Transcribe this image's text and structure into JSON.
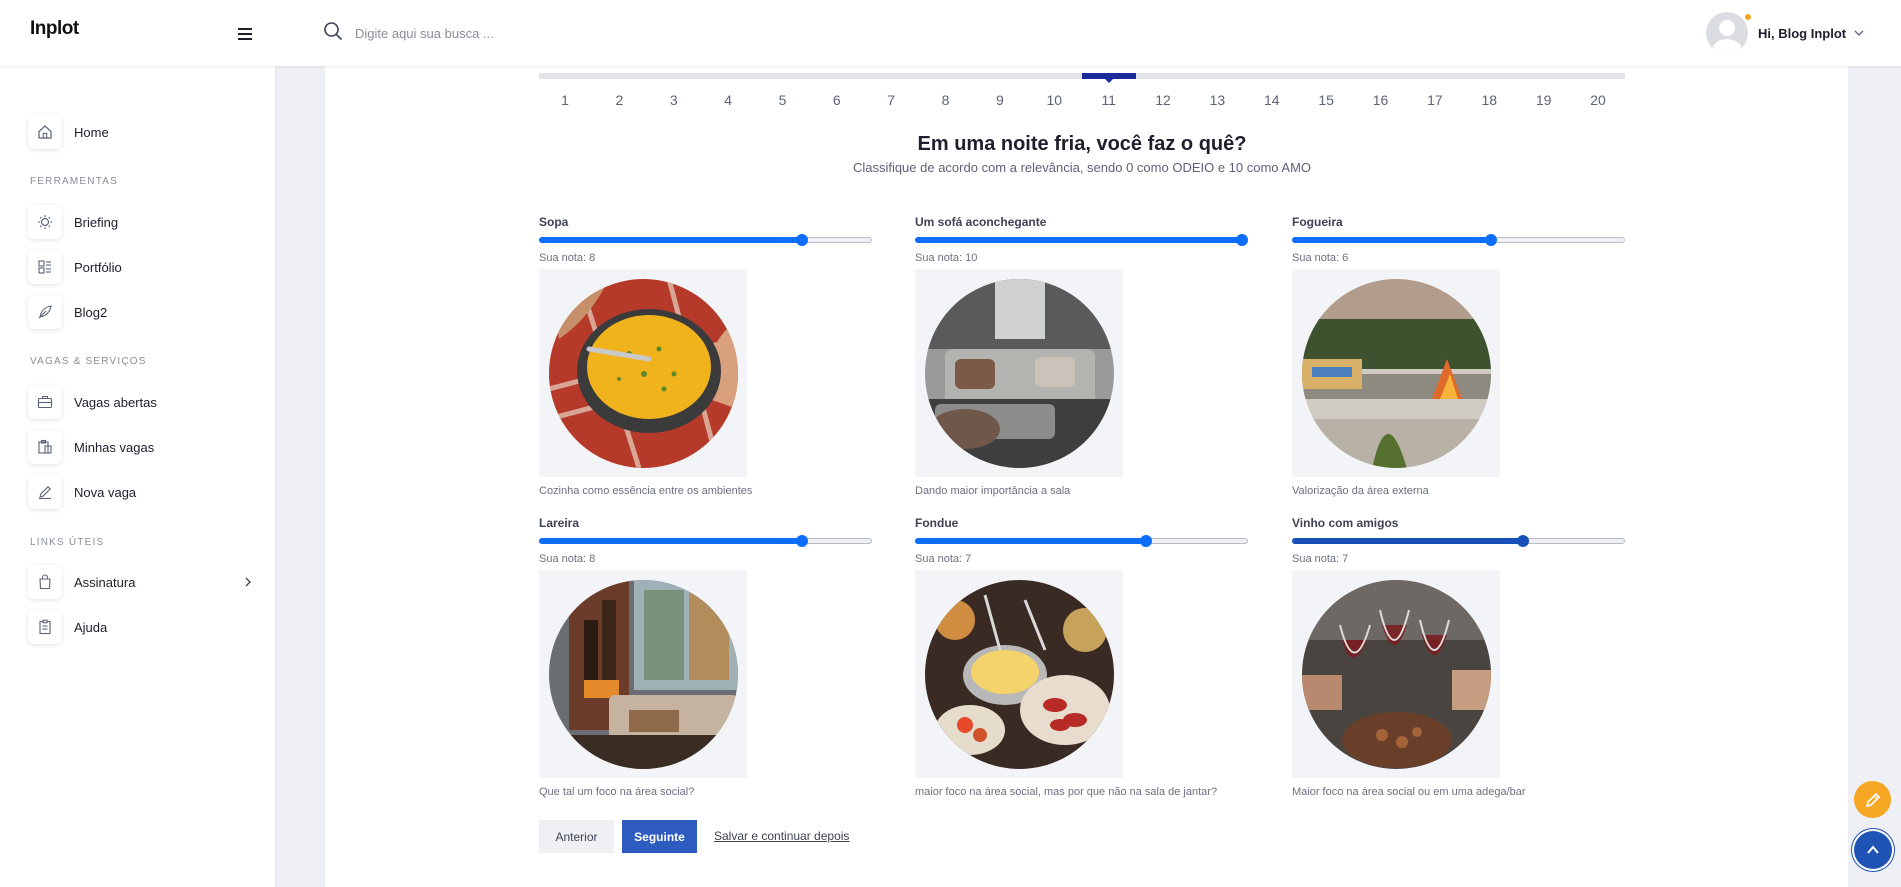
{
  "header": {
    "logo": "Inplot",
    "search_placeholder": "Digite aqui sua busca ...",
    "user_name": "Hi, Blog Inplot"
  },
  "sidebar": {
    "home": "Home",
    "section_tools": "FERRAMENTAS",
    "briefing": "Briefing",
    "portfolio": "Portfólio",
    "blog2": "Blog2",
    "section_jobs": "VAGAS & SERVIÇOS",
    "open_jobs": "Vagas abertas",
    "my_jobs": "Minhas vagas",
    "new_job": "Nova vaga",
    "section_links": "LINKS ÚTEIS",
    "subscription": "Assinatura",
    "help": "Ajuda"
  },
  "steps": {
    "items": [
      "1",
      "2",
      "3",
      "4",
      "5",
      "6",
      "7",
      "8",
      "9",
      "10",
      "11",
      "12",
      "13",
      "14",
      "15",
      "16",
      "17",
      "18",
      "19",
      "20"
    ],
    "current": "11"
  },
  "question": {
    "title": "Em uma noite fria, você faz o quê?",
    "subtitle": "Classifique de acordo com a relevância, sendo 0 como ODEIO e 10 como AMO"
  },
  "items": [
    {
      "title": "Sopa",
      "score_label": "Sua nota: 8",
      "value": 8,
      "max": 10,
      "caption": "Cozinha como essência entre os ambientes"
    },
    {
      "title": "Um sofá aconchegante",
      "score_label": "Sua nota: 10",
      "value": 10,
      "max": 10,
      "caption": "Dando maior importância a sala"
    },
    {
      "title": "Fogueira",
      "score_label": "Sua nota: 6",
      "value": 6,
      "max": 10,
      "caption": "Valorização da área externa"
    },
    {
      "title": "Lareira",
      "score_label": "Sua nota: 8",
      "value": 8,
      "max": 10,
      "caption": "Que tal um foco na área social?"
    },
    {
      "title": "Fondue",
      "score_label": "Sua nota: 7",
      "value": 7,
      "max": 10,
      "caption": "maior foco na área social, mas por que não na sala de jantar?"
    },
    {
      "title": "Vinho com amigos",
      "score_label": "Sua nota: 7",
      "value": 7,
      "max": 10,
      "caption": "Maior foco na área social ou em uma adega/bar"
    }
  ],
  "actions": {
    "previous": "Anterior",
    "next": "Seguinte",
    "save_later": "Salvar e continuar depois"
  },
  "colors": {
    "slider": "#0d6efd",
    "slider_focus": "#1650b8",
    "primary_button": "#2d5bbf",
    "step_active": "#1a2a9a",
    "fab_orange": "#f6a723"
  }
}
